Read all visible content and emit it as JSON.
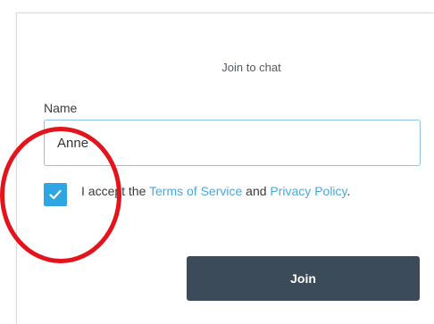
{
  "form": {
    "title": "Join to chat",
    "name_label": "Name",
    "name_value": "Anne",
    "accept": {
      "checked": true,
      "prefix": "I accept the ",
      "terms_link": "Terms of Service",
      "middle": " and ",
      "privacy_link": "Privacy Policy",
      "suffix": "."
    },
    "join_label": "Join"
  },
  "colors": {
    "accent": "#2ea6e3",
    "link": "#4aa9dd",
    "button_bg": "#3c4b59",
    "annotation": "#e3141b"
  }
}
